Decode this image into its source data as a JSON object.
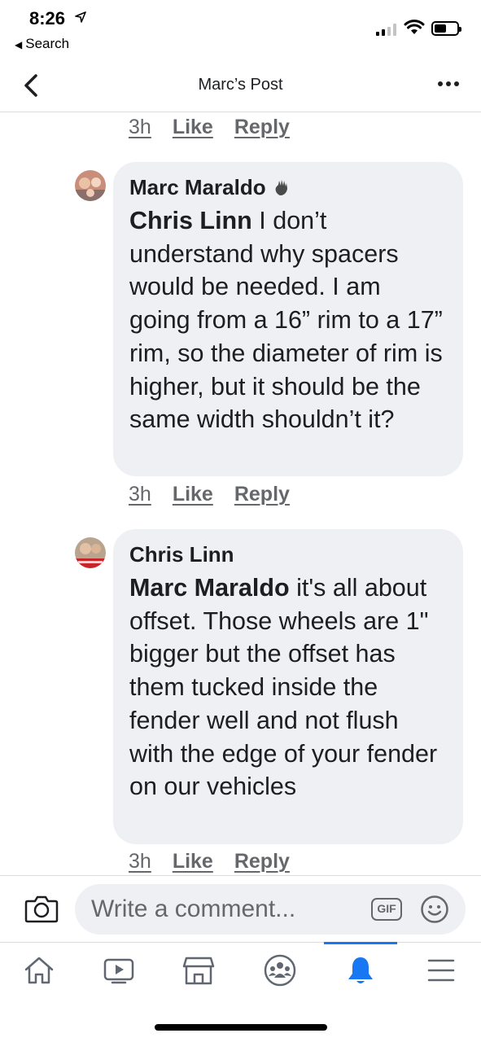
{
  "status_bar": {
    "time": "8:26",
    "back_app_label": "Search"
  },
  "header": {
    "title": "Marc’s Post"
  },
  "comments": [
    {
      "time": "3h",
      "like": "Like",
      "reply": "Reply"
    },
    {
      "author": "Marc Maraldo",
      "mention": "Chris Linn",
      "text": " I don’t understand why spacers would be needed. I am going from a 16” rim to a 17” rim, so the diameter of rim is higher, but it should be the same width shouldn’t it?",
      "time": "3h",
      "like": "Like",
      "reply": "Reply"
    },
    {
      "author": "Chris Linn",
      "mention": "Marc Maraldo",
      "text": " it's all about offset. Those wheels are 1\" bigger but the offset has them tucked inside the  fender well and not flush with the edge of your fender on our vehicles",
      "time": "3h",
      "like": "Like",
      "reply": "Reply"
    }
  ],
  "composer": {
    "placeholder": "Write a comment...",
    "gif_label": "GIF"
  },
  "tabs": [
    "home-icon",
    "watch-icon",
    "marketplace-icon",
    "groups-icon",
    "notifications-icon",
    "menu-icon"
  ],
  "colors": {
    "accent": "#1877f2",
    "bubble": "#eff0f3",
    "secondary_text": "#65676b"
  }
}
